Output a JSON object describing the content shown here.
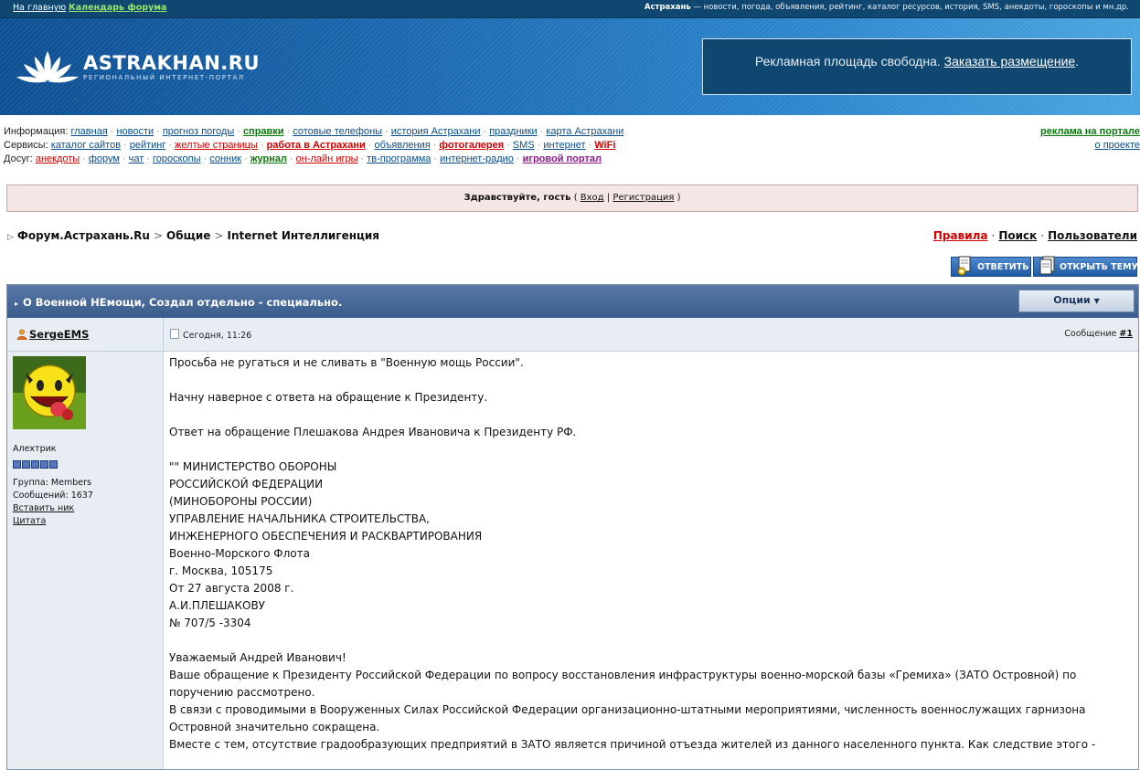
{
  "topbar": {
    "home": "На главную",
    "calendar": "Календарь форума",
    "tagline_bold": "Астрахань",
    "tagline_rest": " — новости, погода, объявления, рейтинг, каталог ресурсов, история, SMS, анекдоты, гороскопы и мн.др."
  },
  "banner": {
    "logo": "ASTRAKHAN.RU",
    "logo_sub": "РЕГИОНАЛЬНЫЙ ИНТЕРНЕТ-ПОРТАЛ",
    "ad_text": "Рекламная площадь свободна. ",
    "ad_link": "Заказать размещение",
    "ad_end": "."
  },
  "nav": {
    "info_label": "Информация:",
    "info": [
      "главная",
      "новости",
      "прогноз погоды",
      "справки",
      "сотовые телефоны",
      "история Астрахани",
      "праздники",
      "карта Астрахани"
    ],
    "services_label": "Сервисы:",
    "services": [
      "каталог сайтов",
      "рейтинг",
      "желтые страницы",
      "работа в Астрахани",
      "объявления",
      "фотогалерея",
      "SMS",
      "интернет",
      "WiFi"
    ],
    "leisure_label": "Досуг:",
    "leisure": [
      "анекдоты",
      "форум",
      "чат",
      "гороскопы",
      "сонник",
      "журнал",
      "он-лайн игры",
      "тв-программа",
      "интернет-радио",
      "игровой портал"
    ],
    "right_top": "реклама на портале",
    "right_bottom": "о проекте"
  },
  "welcome": {
    "greeting": "Здравствуйте, гость",
    "open": " ( ",
    "login": "Вход",
    "sep": " | ",
    "register": "Регистрация",
    "close": " )"
  },
  "breadcrumb": {
    "root": "Форум.Астрахань.Ru",
    "section": "Общие",
    "forum": "Internet Интеллигенция"
  },
  "toplinks": {
    "rules": "Правила",
    "search": "Поиск",
    "users": "Пользователи"
  },
  "buttons": {
    "reply": "ОТВЕТИТЬ",
    "new_topic": "ОТКРЫТЬ ТЕМУ"
  },
  "topic": {
    "title": "О Военной НЕмощи, Создал отдельно - специально.",
    "options": "Опции"
  },
  "post": {
    "author": "SergeEMS",
    "rank": "Алехтрик",
    "group": "Группа: Members",
    "messages": "Сообщений: 1637",
    "insert_nick": "Вставить ник",
    "quote": "Цитата",
    "date": "Сегодня, 11:26",
    "msg_label": "Сообщение ",
    "msg_num": "#1",
    "lines": [
      "Просьба не ругаться и не сливать в \"Военную мощь России\".",
      "",
      "Начну наверное с ответа на обращение к Президенту.",
      "",
      "Ответ на обращение Плешакова Андрея Ивановича к Президенту РФ.",
      "",
      "\"\" МИНИСТЕРСТВО ОБОРОНЫ",
      "РОССИЙСКОЙ ФЕДЕРАЦИИ",
      "(МИНОБОРОНЫ РОССИИ)",
      "УПРАВЛЕНИЕ НАЧАЛЬНИКА СТРОИТЕЛЬСТВА,",
      "ИНЖЕНЕРНОГО ОБЕСПЕЧЕНИЯ И РАСКВАРТИРОВАНИЯ",
      "Военно-Морского Флота",
      "г. Москва, 105175",
      "От 27 августа 2008 г.",
      "А.И.ПЛЕШАКОВУ",
      "№ 707/5 -3304",
      "",
      "Уважаемый Андрей Иванович!",
      "Ваше обращение к Президенту Российской Федерации по вопросу восстановления инфраструктуры военно-морской базы «Гремиха» (ЗАТО Островной) по поручению рассмотрено.",
      "В связи с проводимыми в Вооруженных Силах Российской Федерации организационно-штатными мероприятиями, численность военнослужащих гарнизона Островной значительно сокращена.",
      "Вместе с тем, отсутствие градообразующих предприятий в ЗАТО является причиной отъезда жителей из данного населенного пункта. Как следствие этого -"
    ]
  }
}
